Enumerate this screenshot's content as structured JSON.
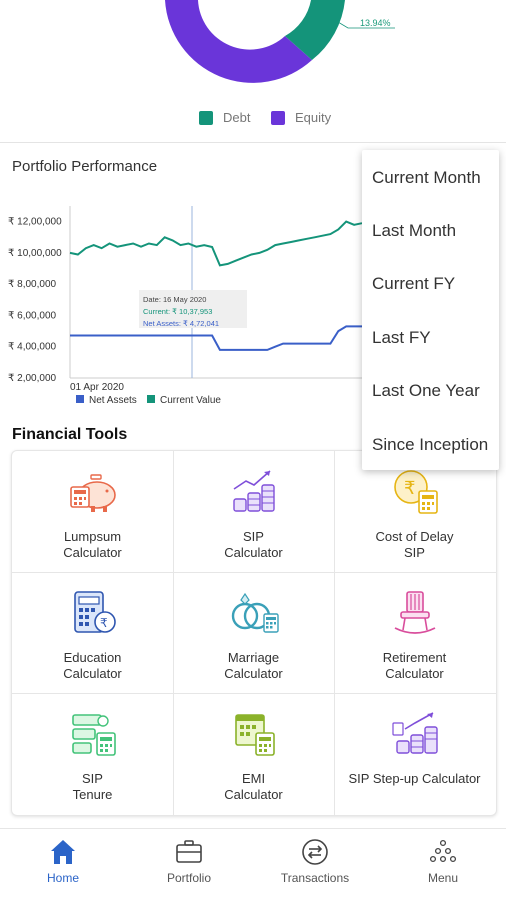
{
  "allocation": {
    "equity_pct_label": "13.94%",
    "legend": [
      {
        "label": "Debt",
        "color": "#14947a"
      },
      {
        "label": "Equity",
        "color": "#6a35d9"
      }
    ]
  },
  "performance": {
    "title": "Portfolio Performance",
    "y_ticks": [
      "₹ 12,00,000",
      "₹ 10,00,000",
      "₹ 8,00,000",
      "₹ 6,00,000",
      "₹ 4,00,000",
      "₹ 2,00,000"
    ],
    "x_start_label": "01 Apr 2020",
    "tooltip": {
      "date": "Date: 16 May 2020",
      "current": "Current: ₹ 10,37,953",
      "net_assets": "Net Assets: ₹ 4,72,041"
    },
    "legend": [
      {
        "label": "Net Assets",
        "color": "#3a5fc8"
      },
      {
        "label": "Current Value",
        "color": "#14947a"
      }
    ]
  },
  "chart_data": {
    "type": "line",
    "ylim": [
      200000,
      1300000
    ],
    "x_start": "01 Apr 2020",
    "series": [
      {
        "name": "Current Value",
        "color": "#14947a",
        "values": [
          1000000,
          990000,
          1030000,
          1050000,
          1030000,
          1060000,
          1040000,
          1050000,
          1060000,
          1040000,
          1060000,
          1050000,
          1100000,
          1080000,
          1050000,
          1060000,
          1040000,
          1050000,
          1037953,
          920000,
          930000,
          950000,
          970000,
          990000,
          1000000,
          1020000,
          1050000,
          1060000,
          1070000,
          1080000,
          1090000,
          1100000,
          1110000,
          1120000,
          1150000,
          1200000,
          1180000,
          1190000
        ]
      },
      {
        "name": "Net Assets",
        "color": "#3a5fc8",
        "values": [
          472041,
          472041,
          472041,
          472041,
          472041,
          472041,
          472041,
          472041,
          472041,
          472041,
          472041,
          472041,
          472041,
          472041,
          472041,
          472041,
          472041,
          472041,
          472041,
          380000,
          380000,
          380000,
          380000,
          380000,
          380000,
          380000,
          400000,
          420000,
          420000,
          420000,
          420000,
          420000,
          420000,
          420000,
          500000,
          530000,
          530000,
          530000
        ]
      }
    ]
  },
  "period_menu": {
    "items": [
      "Current Month",
      "Last Month",
      "Current FY",
      "Last FY",
      "Last One Year",
      "Since Inception"
    ]
  },
  "tools": {
    "title": "Financial Tools",
    "items": [
      {
        "line1": "Lumpsum",
        "line2": "Calculator",
        "icon": "piggy-bank-icon"
      },
      {
        "line1": "SIP",
        "line2": "Calculator",
        "icon": "coins-growth-icon"
      },
      {
        "line1": "Cost of Delay",
        "line2": "SIP",
        "icon": "rupee-coin-calculator-icon"
      },
      {
        "line1": "Education",
        "line2": "Calculator",
        "icon": "calculator-rupee-icon"
      },
      {
        "line1": "Marriage",
        "line2": "Calculator",
        "icon": "rings-icon"
      },
      {
        "line1": "Retirement",
        "line2": "Calculator",
        "icon": "rocking-chair-icon"
      },
      {
        "line1": "SIP",
        "line2": "Tenure",
        "icon": "sip-tenure-icon"
      },
      {
        "line1": "EMI",
        "line2": "Calculator",
        "icon": "calendar-calculator-icon"
      },
      {
        "line1": "SIP Step-up Calculator",
        "line2": "",
        "icon": "step-up-coins-icon"
      }
    ]
  },
  "nav": {
    "items": [
      {
        "label": "Home",
        "icon": "home-icon",
        "active": true
      },
      {
        "label": "Portfolio",
        "icon": "briefcase-icon",
        "active": false
      },
      {
        "label": "Transactions",
        "icon": "transfer-icon",
        "active": false
      },
      {
        "label": "Menu",
        "icon": "menu-dots-icon",
        "active": false
      }
    ],
    "active_color": "#2b64c8"
  }
}
